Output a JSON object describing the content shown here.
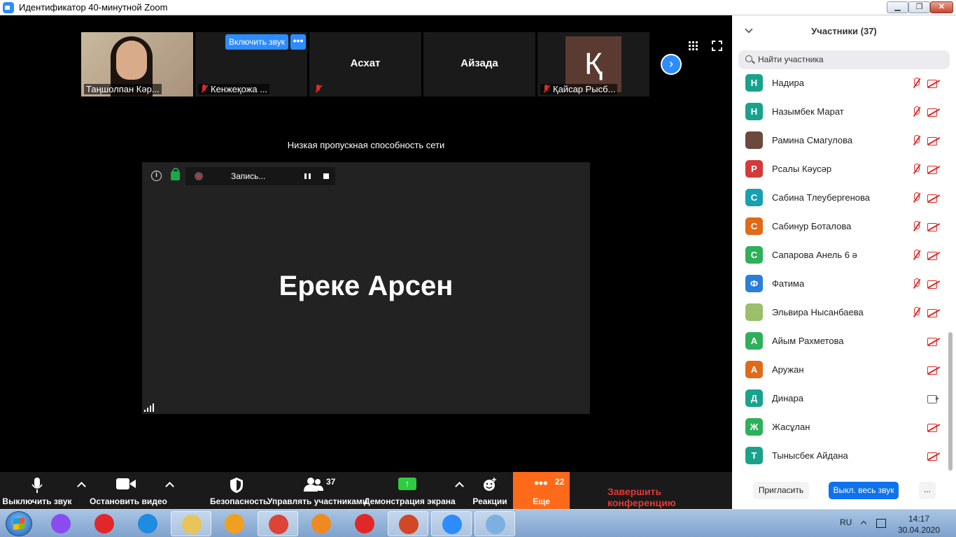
{
  "window": {
    "title": "Идентификатор 40-минутной Zoom"
  },
  "thumbnails": [
    {
      "name": "Таңшолпан Кәр...",
      "type": "video"
    },
    {
      "name": "Кенжеқожа ...",
      "type": "muted",
      "unmute_label": "Включить звук",
      "more_label": "•••"
    },
    {
      "name": "Асхат",
      "type": "name",
      "muted": true
    },
    {
      "name": "Айзада",
      "type": "name"
    },
    {
      "name": "Қайсар Рысб...",
      "type": "avatar",
      "avatar_letter": "Қ",
      "avatar_color": "#5b3b31"
    }
  ],
  "stage": {
    "network_notice": "Низкая пропускная способность сети",
    "active_speaker": "Ереке Арсен",
    "recording_label": "Запись...",
    "info_icon_text": "i"
  },
  "toolbar": {
    "mute": "Выключить звук",
    "stop_video": "Остановить видео",
    "security": "Безопасность",
    "participants": "Управлять участниками",
    "participants_count": "37",
    "share": "Демонстрация экрана",
    "reactions": "Реакции",
    "more": "Еще",
    "more_count": "22",
    "end": "Завершить конференцию",
    "more_color": "#ff6a1a",
    "end_color": "#e53935"
  },
  "panel": {
    "title": "Участники (37)",
    "search_placeholder": "Найти участника",
    "participants": [
      {
        "name": "Надира",
        "letter": "Н",
        "color": "#19a28b",
        "mic_off": true,
        "cam_off": true
      },
      {
        "name": "Назымбек Марат",
        "letter": "Н",
        "color": "#19a28b",
        "mic_off": true,
        "cam_off": true
      },
      {
        "name": "Рамина Смагулова",
        "letter": "",
        "color": "#6b4a3e",
        "mic_off": true,
        "cam_off": true,
        "photo": true
      },
      {
        "name": "Рсалы Кәусәр",
        "letter": "Р",
        "color": "#d43a3a",
        "mic_off": true,
        "cam_off": true
      },
      {
        "name": "Сабина Тлеубергенова",
        "letter": "С",
        "color": "#1a9fb0",
        "mic_off": true,
        "cam_off": true
      },
      {
        "name": "Сабинур Боталова",
        "letter": "С",
        "color": "#e06a1a",
        "mic_off": true,
        "cam_off": true
      },
      {
        "name": "Сапарова Анель 6 ә",
        "letter": "С",
        "color": "#2eb05a",
        "mic_off": true,
        "cam_off": true
      },
      {
        "name": "Фатима",
        "letter": "Ф",
        "color": "#2a7ed6",
        "mic_off": true,
        "cam_off": true
      },
      {
        "name": "Эльвира Нысанбаева",
        "letter": "",
        "color": "#9bbf6a",
        "mic_off": true,
        "cam_off": true,
        "photo": true
      },
      {
        "name": "Айым Рахметова",
        "letter": "А",
        "color": "#2eb05a",
        "mic_off": false,
        "cam_off": true
      },
      {
        "name": "Аружан",
        "letter": "А",
        "color": "#e06a1a",
        "mic_off": false,
        "cam_off": true
      },
      {
        "name": "Динара",
        "letter": "Д",
        "color": "#19a28b",
        "mic_off": false,
        "cam_off": false
      },
      {
        "name": "Жасұлан",
        "letter": "Ж",
        "color": "#2eb05a",
        "mic_off": false,
        "cam_off": true
      },
      {
        "name": "Тынысбек Айдана",
        "letter": "Т",
        "color": "#19a28b",
        "mic_off": false,
        "cam_off": true
      }
    ],
    "invite": "Пригласить",
    "mute_all": "Выкл. весь звук",
    "more": "..."
  },
  "taskbar": {
    "apps": [
      {
        "name": "alice-icon",
        "color": "#8a4cf0",
        "active": false
      },
      {
        "name": "yandex-icon",
        "color": "#e02828",
        "active": false
      },
      {
        "name": "ie-icon",
        "color": "#1e8ce0",
        "active": false
      },
      {
        "name": "explorer-icon",
        "color": "#e8c45a",
        "active": true
      },
      {
        "name": "avast-icon",
        "color": "#f0a020",
        "active": false
      },
      {
        "name": "chrome-icon",
        "color": "#db4437",
        "active": true
      },
      {
        "name": "media-player-icon",
        "color": "#f08a20",
        "active": false
      },
      {
        "name": "yandex-browser-icon",
        "color": "#e02828",
        "active": false
      },
      {
        "name": "powerpoint-icon",
        "color": "#d24726",
        "active": true
      },
      {
        "name": "zoom-icon",
        "color": "#2d8cff",
        "active": true
      },
      {
        "name": "paint-icon",
        "color": "#7db0e0",
        "active": true
      }
    ],
    "lang": "RU",
    "time": "14:17",
    "date": "30.04.2020"
  }
}
